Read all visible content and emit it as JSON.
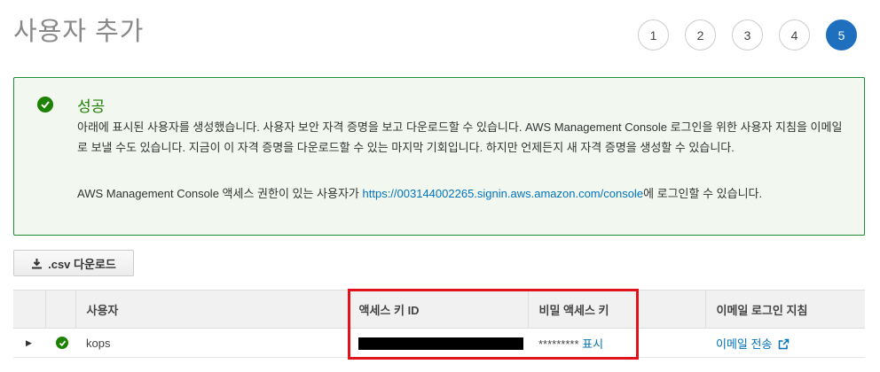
{
  "page": {
    "title": "사용자 추가"
  },
  "steps": [
    {
      "label": "1",
      "active": false
    },
    {
      "label": "2",
      "active": false
    },
    {
      "label": "3",
      "active": false
    },
    {
      "label": "4",
      "active": false
    },
    {
      "label": "5",
      "active": true
    }
  ],
  "alert": {
    "title": "성공",
    "body": "아래에 표시된 사용자를 생성했습니다. 사용자 보안 자격 증명을 보고 다운로드할 수 있습니다. AWS Management Console 로그인을 위한 사용자 지침을 이메일로 보낼 수도 있습니다. 지금이 이 자격 증명을 다운로드할 수 있는 마지막 기회입니다. 하지만 언제든지 새 자격 증명을 생성할 수 있습니다.",
    "console_prefix": "AWS Management Console 액세스 권한이 있는 사용자가 ",
    "console_link": "https://003144002265.signin.aws.amazon.com/console",
    "console_suffix": "에 로그인할 수 있습니다."
  },
  "toolbar": {
    "csv_label": ".csv 다운로드"
  },
  "table": {
    "headers": [
      "",
      "",
      "사용자",
      "액세스 키 ID",
      "비밀 액세스 키",
      "이메일 로그인 지침"
    ],
    "rows": [
      {
        "user": "kops",
        "access_key_id": "",
        "secret_masked": "*********",
        "secret_show": "표시",
        "email_link": "이메일 전송"
      }
    ]
  },
  "colors": {
    "accent": "#1f6fbf",
    "success": "#1d8102",
    "link": "#0073bb",
    "highlight": "#e0131a"
  }
}
